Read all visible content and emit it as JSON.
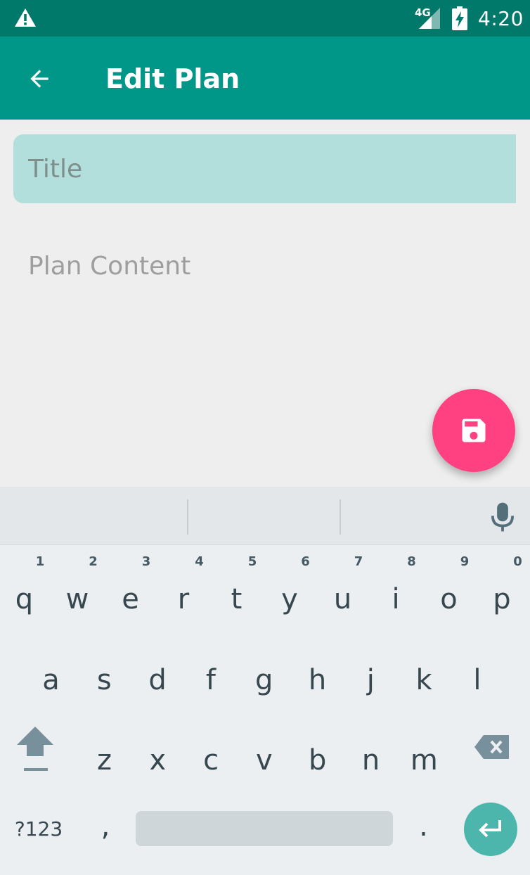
{
  "status_bar": {
    "time": "4:20",
    "network_label": "4G",
    "icons": [
      "warning-icon",
      "cell-signal-icon",
      "battery-charging-icon"
    ]
  },
  "app_bar": {
    "title": "Edit Plan",
    "back_icon": "arrow-back-icon",
    "background_color": "#009688"
  },
  "form": {
    "title_placeholder": "Title",
    "title_value": "",
    "content_placeholder": "Plan Content",
    "content_value": ""
  },
  "fab": {
    "icon": "save-icon",
    "color": "#ff4081"
  },
  "keyboard": {
    "row1": [
      "q",
      "w",
      "e",
      "r",
      "t",
      "y",
      "u",
      "i",
      "o",
      "p"
    ],
    "row1_hints": [
      "1",
      "2",
      "3",
      "4",
      "5",
      "6",
      "7",
      "8",
      "9",
      "0"
    ],
    "row2": [
      "a",
      "s",
      "d",
      "f",
      "g",
      "h",
      "j",
      "k",
      "l"
    ],
    "row3": [
      "z",
      "x",
      "c",
      "v",
      "b",
      "n",
      "m"
    ],
    "symbols_label": "?123",
    "comma": ",",
    "period": ".",
    "icons": [
      "mic-icon",
      "shift-icon",
      "backspace-icon",
      "enter-icon"
    ]
  }
}
